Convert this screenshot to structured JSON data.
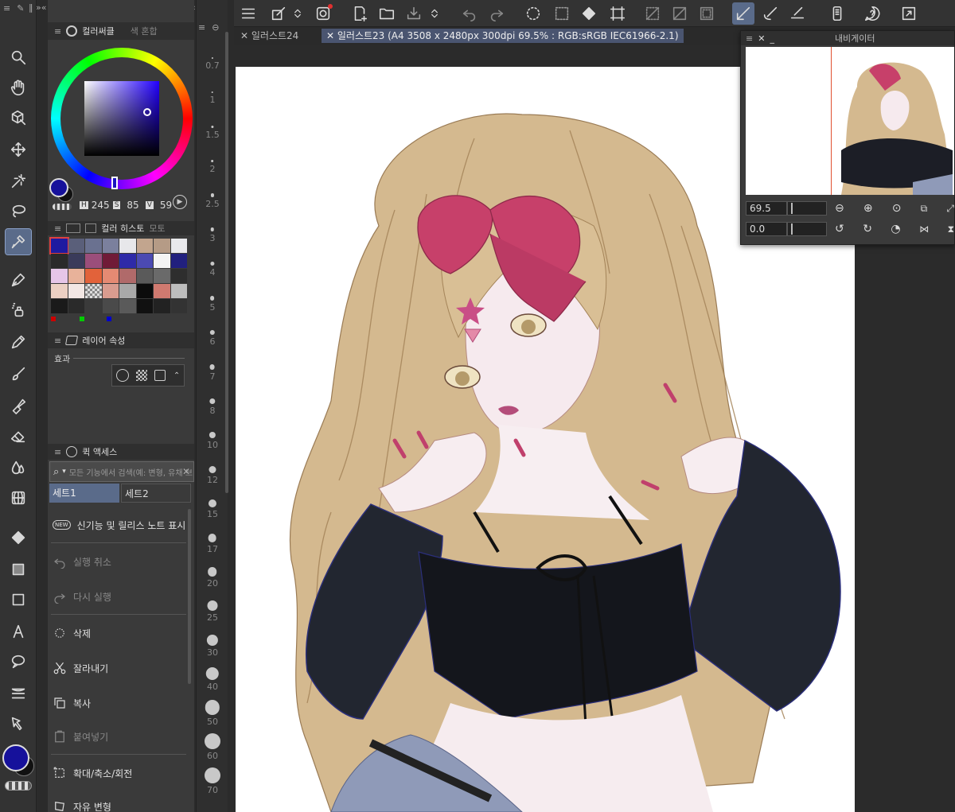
{
  "colors": {
    "main_color": "#16119b",
    "accent": "#5a6b8a",
    "canvas_bg": "#2b2b2b"
  },
  "color_panel": {
    "tab_active": "컬러써클",
    "tab_inactive": "색 혼합",
    "h_label": "H",
    "h_value": "245",
    "s_label": "S",
    "s_value": "85",
    "v_label": "V",
    "v_value": "59"
  },
  "color_set_panel": {
    "tab_history": "컬러 히스토",
    "tab_more": "모토",
    "swatches": [
      [
        "#1e1aa0",
        "#5a5f7a",
        "#6a7190",
        "#7b809d",
        "#e7e7ea",
        "#c2a58e",
        "#b59b86",
        "#e9e9ec"
      ],
      [
        "#2a2a2a",
        "#3a3b5a",
        "#9b4e7b",
        "#701b37",
        "#2e2aa8",
        "#4b4ab2",
        "#f4f4f4",
        "#21207e"
      ],
      [
        "#e6c6e8",
        "#e8b29a",
        "#e2623a",
        "#e58a73",
        "#b06a6a",
        "#5a5a5a",
        "#6a6a6a",
        "#2e2e2e"
      ],
      [
        "#ecd0c3",
        "#f2e7e4",
        "checker",
        "#d99c8f",
        "#a8a8a8",
        "#0c0c0c",
        "#d07a70",
        "#bdbdbd"
      ],
      [
        "#1a1a1a",
        "#2a2a2a",
        "#3a3a3a",
        "#4a4a4a",
        "#5a5a5a",
        "#111111",
        "#222222",
        "#333333"
      ]
    ]
  },
  "layer_props": {
    "title": "레이어 속성",
    "effect_label": "효과"
  },
  "quick_access": {
    "title": "퀵 액세스",
    "search_placeholder": "모든 기능에서 검색(예: 변형, 유채 브",
    "set1": "세트1",
    "set2": "세트2",
    "items": [
      "신기능 및 릴리스 노트 표시",
      "실행 취소",
      "다시 실행",
      "삭제",
      "잘라내기",
      "복사",
      "붙여넣기",
      "확대/축소/회전",
      "자유 변형"
    ],
    "new_badge": "NEW"
  },
  "brush_sizes": [
    "0.7",
    "1",
    "1.5",
    "2",
    "2.5",
    "3",
    "4",
    "5",
    "6",
    "7",
    "8",
    "10",
    "12",
    "15",
    "17",
    "20",
    "25",
    "30",
    "40",
    "50",
    "60",
    "70"
  ],
  "doc_tabs": [
    {
      "label": "일러스트24"
    },
    {
      "label": "일러스트23 (A4 3508 x 2480px 300dpi 69.5% : RGB:sRGB IEC61966-2.1)"
    }
  ],
  "navigator": {
    "title": "내비게이터",
    "zoom_value": "69.5",
    "rotate_value": "0.0"
  }
}
